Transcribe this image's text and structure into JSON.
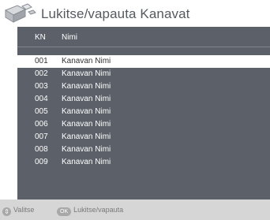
{
  "title": "Lukitse/vapauta Kanavat",
  "columns": {
    "kn": "KN",
    "name": "Nimi"
  },
  "rows": [
    {
      "num": "001",
      "name": "Kanavan Nimi"
    },
    {
      "num": "002",
      "name": "Kanavan Nimi"
    },
    {
      "num": "003",
      "name": "Kanavan Nimi"
    },
    {
      "num": "004",
      "name": "Kanavan Nimi"
    },
    {
      "num": "005",
      "name": "Kanavan Nimi"
    },
    {
      "num": "006",
      "name": "Kanavan Nimi"
    },
    {
      "num": "007",
      "name": "Kanavan Nimi"
    },
    {
      "num": "008",
      "name": "Kanavan Nimi"
    },
    {
      "num": "009",
      "name": "Kanavan Nimi"
    }
  ],
  "selected_row": "001",
  "footer": {
    "select": {
      "icon": "updown-arrows-icon",
      "key": "⇕",
      "label": "Valitse"
    },
    "ok": {
      "key": "OK",
      "label": "Lukitse/vapauta"
    }
  },
  "colors": {
    "panel": "#5b6069",
    "selected_row": "#ffffff",
    "footer": "#d6d6d6"
  }
}
